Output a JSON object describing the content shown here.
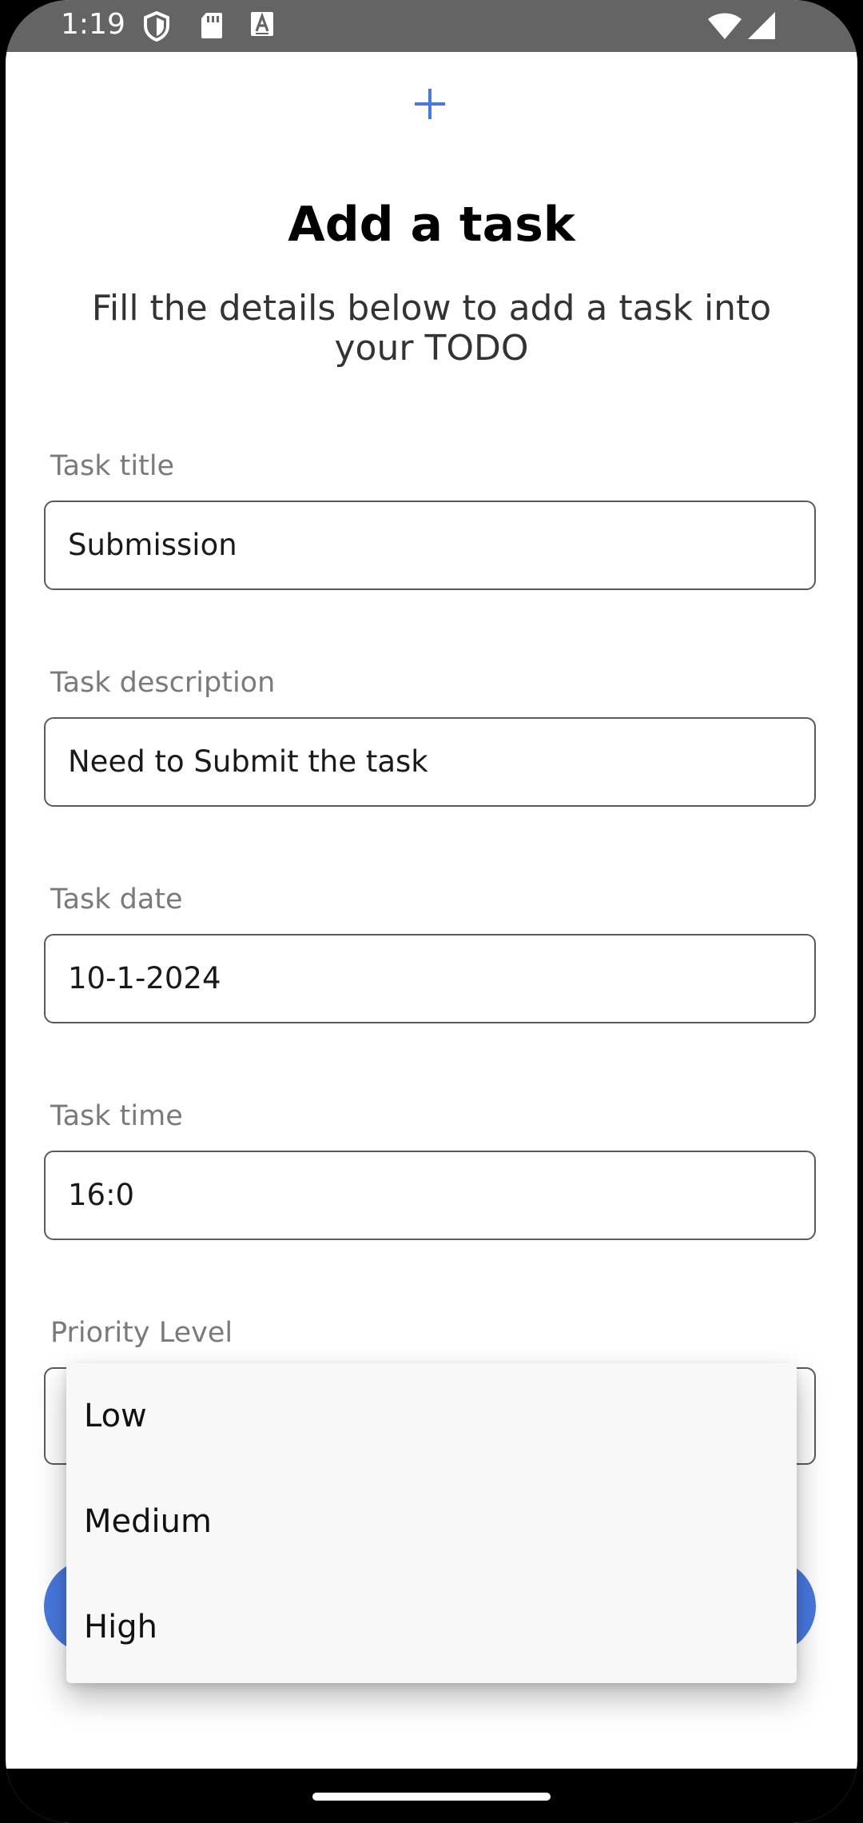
{
  "status_bar": {
    "time": "1:19",
    "icons": [
      "shield-icon",
      "sd-card-icon",
      "text-a-icon",
      "wifi-icon",
      "signal-icon"
    ]
  },
  "header": {
    "icon": "plus-icon",
    "title": "Add a task",
    "subtitle": "Fill the details below to add a task into your TODO"
  },
  "form": {
    "title_label": "Task title",
    "title_value": "Submission",
    "description_label": "Task description",
    "description_value": "Need to Submit the task",
    "date_label": "Task date",
    "date_value": "10-1-2024",
    "time_label": "Task time",
    "time_value": "16:0",
    "priority_label": "Priority Level"
  },
  "dropdown": {
    "options": [
      "Low",
      "Medium",
      "High"
    ]
  },
  "colors": {
    "accent": "#4779e0",
    "status_bar": "#646464",
    "label": "#7a7a7a"
  }
}
